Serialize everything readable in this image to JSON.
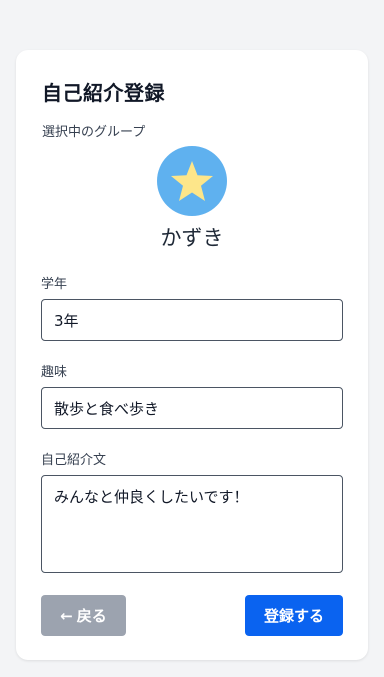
{
  "form": {
    "title": "自己紹介登録",
    "group_label": "選択中のグループ",
    "group_name": "かずき",
    "group_icon": "star-icon",
    "colors": {
      "avatar_bg": "#5fb1ef",
      "star": "#fde68a",
      "primary": "#0a63f0",
      "secondary": "#9ca3af"
    },
    "fields": {
      "grade": {
        "label": "学年",
        "value": "3年"
      },
      "hobby": {
        "label": "趣味",
        "value": "散歩と食べ歩き"
      },
      "intro": {
        "label": "自己紹介文",
        "value": "みんなと仲良くしたいです！"
      }
    },
    "buttons": {
      "back_arrow": "←",
      "back_label": "戻る",
      "submit_label": "登録する"
    }
  }
}
